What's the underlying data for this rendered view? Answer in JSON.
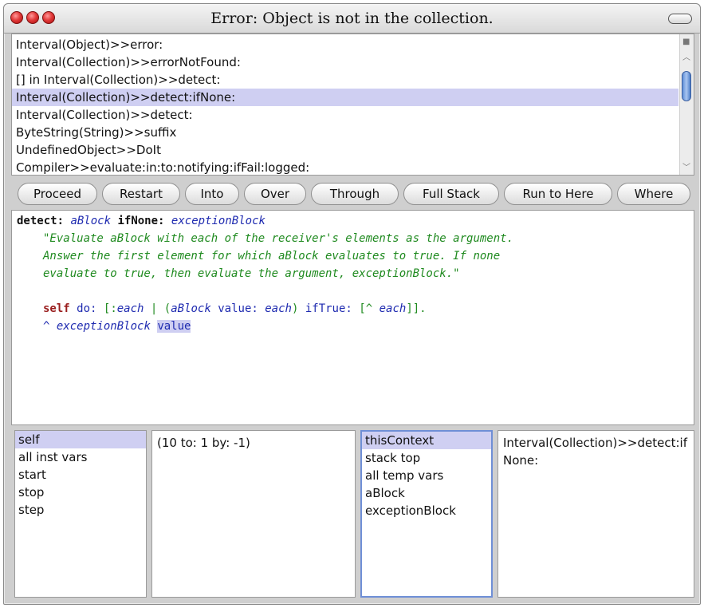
{
  "window": {
    "title": "Error: Object is not in the collection."
  },
  "stack": {
    "items": [
      "Interval(Object)>>error:",
      "Interval(Collection)>>errorNotFound:",
      "[] in Interval(Collection)>>detect:",
      "Interval(Collection)>>detect:ifNone:",
      "Interval(Collection)>>detect:",
      "ByteString(String)>>suffix",
      "UndefinedObject>>DoIt",
      "Compiler>>evaluate:in:to:notifying:ifFail:logged:"
    ],
    "selected_index": 3
  },
  "buttons": [
    "Proceed",
    "Restart",
    "Into",
    "Over",
    "Through",
    "Full Stack",
    "Run to Here",
    "Where"
  ],
  "code": {
    "sel1": "detect:",
    "arg1": "aBlock",
    "sel2": "ifNone:",
    "arg2": "exceptionBlock",
    "comment1": "\"Evaluate aBlock with each of the receiver's elements as the argument.",
    "comment2": "Answer the first element for which aBlock evaluates to true. If none",
    "comment3": "evaluate to true, then evaluate the argument, exceptionBlock.\"",
    "self": "self",
    "do": "do:",
    "open_block": "[:",
    "each": "each",
    "bar": "|",
    "paren_open": "(",
    "ablock": "aBlock",
    "value_msg": "value:",
    "each2": "each",
    "paren_close": ")",
    "iftrue": "ifTrue:",
    "ret_block_open": "[^",
    "each3": "each",
    "close_blocks": "]].",
    "caret": "^",
    "exceptionBlock": "exceptionBlock",
    "value": "value"
  },
  "receiver_fields": [
    "self",
    "all inst vars",
    "start",
    "stop",
    "step"
  ],
  "receiver_selected": 0,
  "receiver_value": "(10 to: 1 by: -1)",
  "context_fields": [
    "thisContext",
    "stack top",
    "all temp vars",
    "aBlock",
    "exceptionBlock"
  ],
  "context_selected": 0,
  "context_value": "Interval(Collection)>>detect:ifNone:",
  "colors": {
    "selection": "#cfcff2",
    "comment": "#1f8a1f",
    "argument": "#1f2bb0",
    "self": "#9a1f1f"
  }
}
